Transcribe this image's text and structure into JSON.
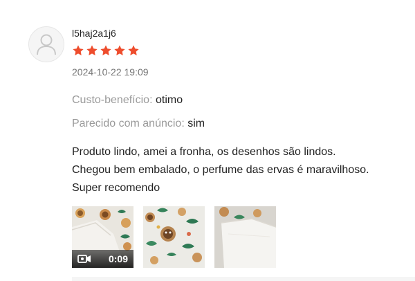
{
  "review": {
    "username": "l5haj2a1j6",
    "rating": 5,
    "rating_max": 5,
    "timestamp": "2024-10-22 19:09",
    "attributes": [
      {
        "label": "Custo-benefício:",
        "value": "otimo"
      },
      {
        "label": "Parecido com anúncio:",
        "value": "sim"
      }
    ],
    "comment_lines": [
      "Produto lindo, amei a fronha, os desenhos são lindos.",
      "Chegou bem embalado, o perfume das ervas é maravilhoso.",
      "Super recomendo"
    ],
    "media": [
      {
        "type": "video",
        "duration": "0:09",
        "icon": "video-camera-icon"
      },
      {
        "type": "image"
      },
      {
        "type": "image"
      }
    ]
  },
  "colors": {
    "star": "#ee4d2d",
    "label_gray": "#9a9a9a",
    "timestamp_gray": "#757575",
    "text": "#222222"
  }
}
